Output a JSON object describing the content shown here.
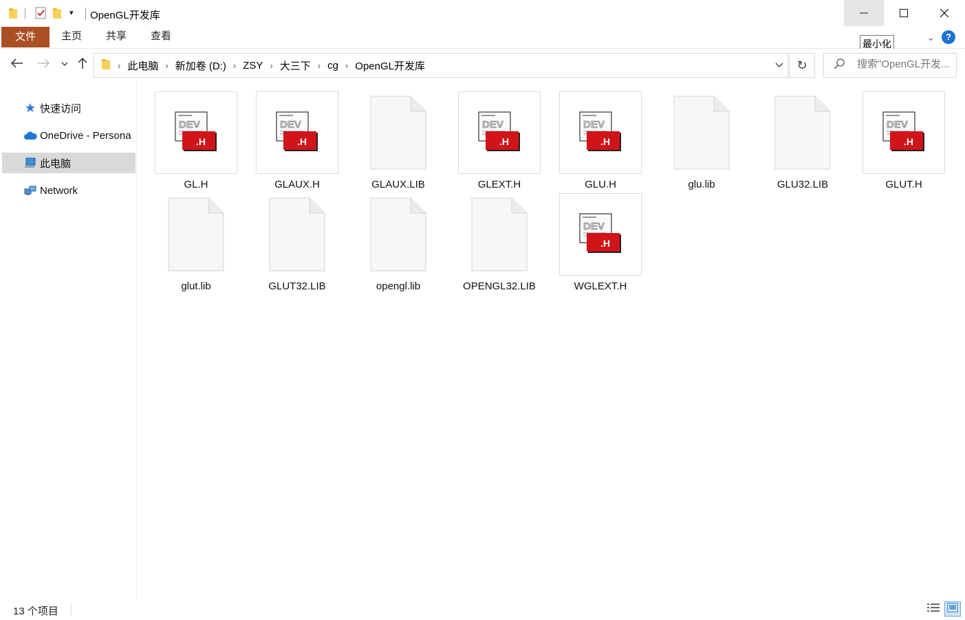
{
  "window": {
    "title": "OpenGL开发库",
    "minimize_tooltip": "最小化"
  },
  "ribbon": {
    "tabs": [
      "文件",
      "主页",
      "共享",
      "查看"
    ]
  },
  "address": {
    "crumbs": [
      "此电脑",
      "新加卷 (D:)",
      "ZSY",
      "大三下",
      "cg",
      "OpenGL开发库"
    ]
  },
  "search": {
    "placeholder": "搜索\"OpenGL开发..."
  },
  "sidebar": {
    "items": [
      {
        "label": "快速访问",
        "icon": "star-icon"
      },
      {
        "label": "OneDrive - Persona",
        "icon": "cloud-icon"
      },
      {
        "label": "此电脑",
        "icon": "computer-icon",
        "selected": true
      },
      {
        "label": "Network",
        "icon": "network-icon"
      }
    ]
  },
  "files": [
    {
      "name": "GL.H",
      "type": "header"
    },
    {
      "name": "GLAUX.H",
      "type": "header"
    },
    {
      "name": "GLAUX.LIB",
      "type": "lib"
    },
    {
      "name": "GLEXT.H",
      "type": "header"
    },
    {
      "name": "GLU.H",
      "type": "header"
    },
    {
      "name": "glu.lib",
      "type": "lib"
    },
    {
      "name": "GLU32.LIB",
      "type": "lib"
    },
    {
      "name": "GLUT.H",
      "type": "header"
    },
    {
      "name": "glut.lib",
      "type": "lib"
    },
    {
      "name": "GLUT32.LIB",
      "type": "lib"
    },
    {
      "name": "opengl.lib",
      "type": "lib"
    },
    {
      "name": "OPENGL32.LIB",
      "type": "lib"
    },
    {
      "name": "WGLEXT.H",
      "type": "header"
    }
  ],
  "header_badge": ".H",
  "status": {
    "count": "13 个项目"
  },
  "colors": {
    "file_tab": "#ab4f25",
    "badge_red": "#d0141a",
    "selection": "#d9d9d9",
    "help_blue": "#1e73d4"
  }
}
